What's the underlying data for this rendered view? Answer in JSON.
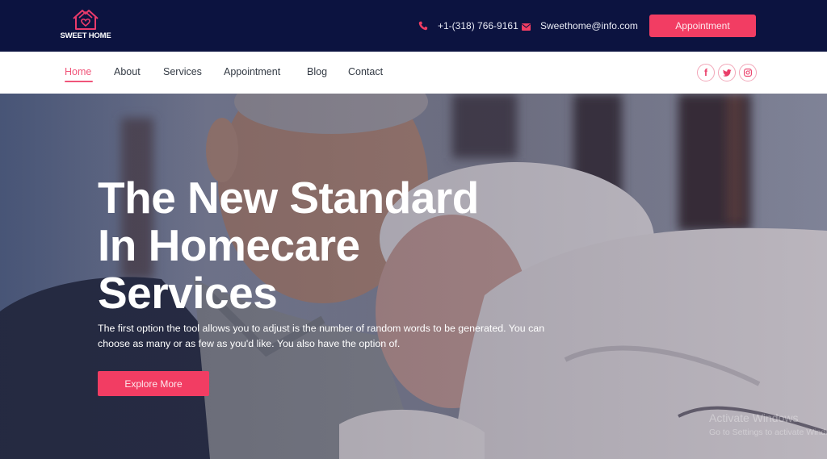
{
  "brand": {
    "name": "SWEET HOME",
    "accent_color": "#f23d63",
    "topbar_color": "#0c1340"
  },
  "topbar": {
    "phone_icon": "phone-icon",
    "phone": "+1-(318) 766-9161",
    "email_icon": "envelope-icon",
    "email": "Sweethome@info.com",
    "appointment_button": "Appointment"
  },
  "nav": {
    "items": [
      {
        "label": "Home",
        "active": true
      },
      {
        "label": "About",
        "active": false
      },
      {
        "label": "Services",
        "active": false
      },
      {
        "label": "Appointment",
        "active": false
      },
      {
        "label": "Blog",
        "active": false
      },
      {
        "label": "Contact",
        "active": false
      }
    ],
    "social": [
      {
        "icon": "facebook-icon",
        "glyph": "f"
      },
      {
        "icon": "twitter-icon",
        "glyph": ""
      },
      {
        "icon": "instagram-icon",
        "glyph": ""
      }
    ]
  },
  "hero": {
    "title_lines": [
      "The New Standard",
      "In Homecare",
      "Services"
    ],
    "description": "The first option the tool allows you to adjust is the number of random words to be generated. You can choose as many or as few as you'd like. You also have the option of.",
    "cta": "Explore More",
    "image": "Elderly couple embracing, smiling"
  },
  "watermark": {
    "title": "Activate Windows",
    "subtitle": "Go to Settings to activate Windows."
  }
}
